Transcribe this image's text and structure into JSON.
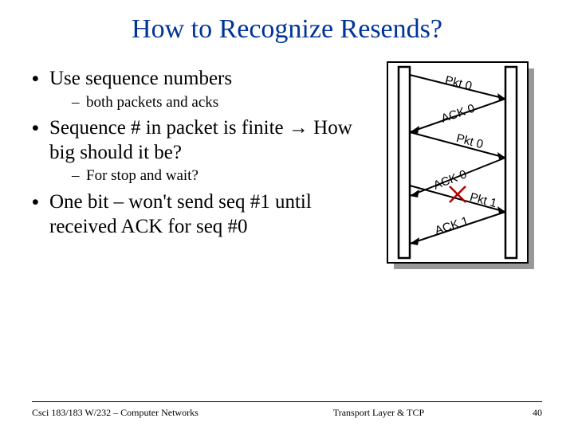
{
  "title": "How to Recognize Resends?",
  "bullets": {
    "b1": "Use sequence numbers",
    "b1s": "both packets and acks",
    "b2": "Sequence # in packet is finite → How big should it be?",
    "b2s": "For stop and wait?",
    "b3": "One bit – won't send seq #1 until received ACK for seq #0"
  },
  "diagram": {
    "m1": "Pkt 0",
    "m2": "ACK 0",
    "m3": "Pkt 0",
    "m4": "ACK 0",
    "m5": "Pkt 1",
    "m6": "ACK 1"
  },
  "footer": {
    "left": "Csci 183/183 W/232 – Computer Networks",
    "center": "Transport Layer & TCP",
    "right": "40"
  }
}
